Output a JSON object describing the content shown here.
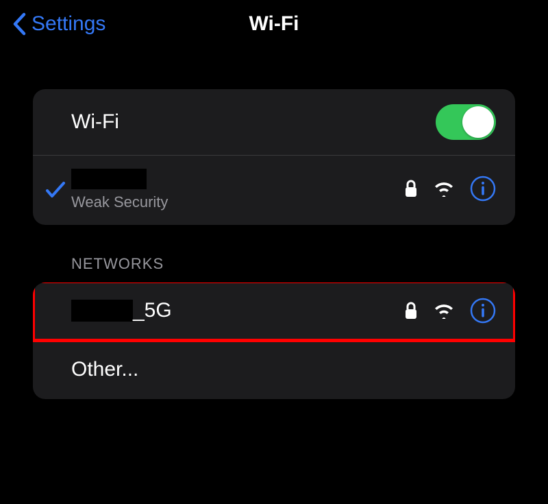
{
  "header": {
    "back_label": "Settings",
    "title": "Wi-Fi"
  },
  "wifi_toggle": {
    "label": "Wi-Fi",
    "enabled": true
  },
  "connected_network": {
    "name_redacted": true,
    "subtitle": "Weak Security",
    "secured": true
  },
  "section_header": "NETWORKS",
  "networks": [
    {
      "name_prefix_redacted": true,
      "name_suffix": "_5G",
      "secured": true,
      "highlighted": true
    }
  ],
  "other_label": "Other...",
  "colors": {
    "accent_blue": "#3478F6",
    "toggle_green": "#34C759",
    "highlight_red": "#FF0000"
  }
}
